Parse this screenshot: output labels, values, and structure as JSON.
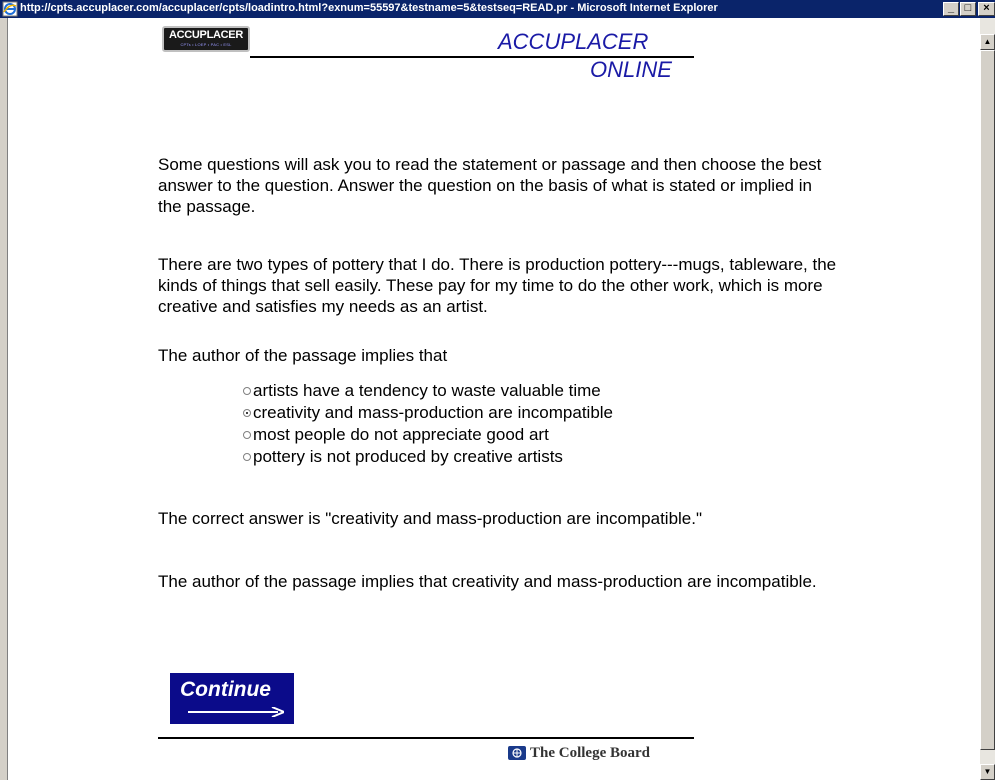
{
  "window": {
    "title": "http://cpts.accuplacer.com/accuplacer/cpts/loadintro.html?exnum=55597&testname=5&testseq=READ.pr - Microsoft Internet Explorer",
    "controls": {
      "minimize": "_",
      "maximize": "□",
      "close": "×"
    },
    "accent_color": "#0a246a"
  },
  "header": {
    "logo_text": "ACCUPLACER",
    "logo_subtext": "CPTs • LOEP • PAC • ESL",
    "brand_line1": "ACCUPLACER",
    "brand_line2": "ONLINE",
    "brand_color": "#1a1aa6"
  },
  "content": {
    "instructions": "Some questions will ask you to read the statement or passage and then choose the best answer to the question.  Answer the question on the basis of what is stated or implied in the passage.",
    "passage": "There are two types of pottery that I do.  There is production pottery---mugs, tableware, the kinds of things that sell easily.  These pay for my time to do the other work, which is more creative and satisfies my needs as an artist.",
    "question": "The author of the passage implies that",
    "options": [
      {
        "label": "artists have a tendency to waste valuable time",
        "selected": false
      },
      {
        "label": "creativity and mass-production are incompatible",
        "selected": true
      },
      {
        "label": "most people do not appreciate good art",
        "selected": false
      },
      {
        "label": "pottery is not produced by creative artists",
        "selected": false
      }
    ],
    "correct_answer_text": "The correct answer is \"creativity and mass-production are incompatible.\"",
    "explanation": "The author of the passage implies that creativity and mass-production are incompatible."
  },
  "continue_button": {
    "label": "Continue",
    "color": "#0b0b8a"
  },
  "footer": {
    "org_name": "The College Board",
    "icon": "college-board-icon"
  },
  "scrollbar": {
    "up_icon": "▲",
    "down_icon": "▼"
  }
}
